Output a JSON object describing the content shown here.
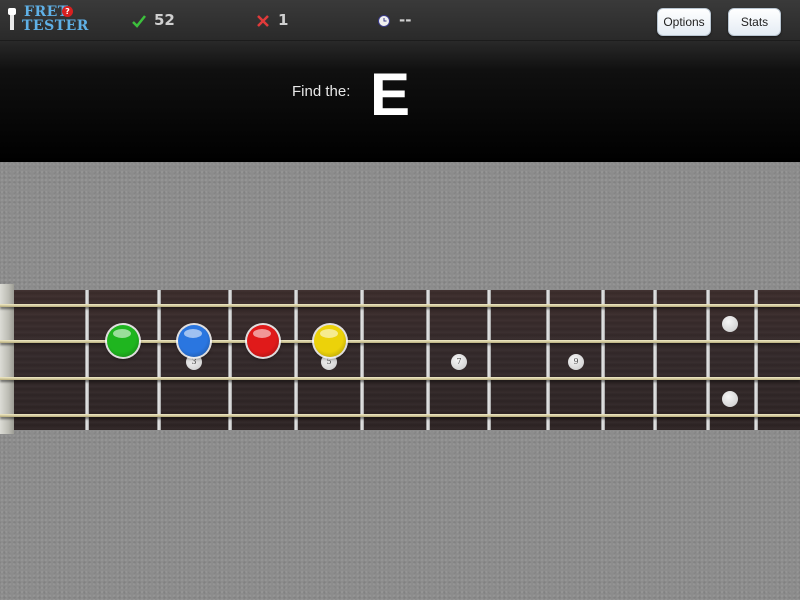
{
  "app": {
    "logo_line1": "FRET",
    "logo_line2": "TESTER",
    "logo_badge": "?"
  },
  "stats": {
    "correct": "52",
    "wrong": "1",
    "timer": "--"
  },
  "toolbar": {
    "options_label": "Options",
    "stats_label": "Stats"
  },
  "prompt": {
    "label": "Find the:",
    "note": "E"
  },
  "fretboard": {
    "frets": 12,
    "strings": 4,
    "fret_markers": [
      {
        "fret": 3,
        "label": "3"
      },
      {
        "fret": 5,
        "label": "5"
      },
      {
        "fret": 7,
        "label": "7"
      },
      {
        "fret": 9,
        "label": "9"
      },
      {
        "fret": 12,
        "label": ""
      },
      {
        "fret": 12,
        "label": ""
      }
    ],
    "answer_dots": [
      {
        "color": "green",
        "hex": "#1fb51f"
      },
      {
        "color": "blue",
        "hex": "#2a76e0"
      },
      {
        "color": "red",
        "hex": "#e01a1a"
      },
      {
        "color": "yellow",
        "hex": "#ecd20a"
      }
    ]
  },
  "icons": {
    "correct": "check-icon",
    "wrong": "x-icon",
    "timer": "clock-icon",
    "logo": "key-icon"
  }
}
